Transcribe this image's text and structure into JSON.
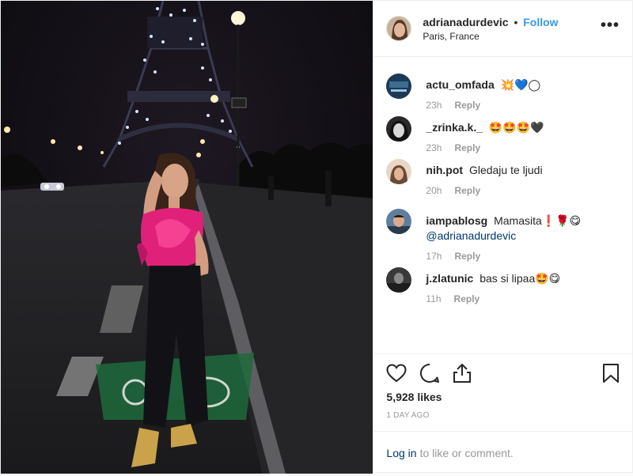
{
  "post": {
    "username": "adrianadurdevic",
    "separator": "•",
    "follow_label": "Follow",
    "location": "Paris, France",
    "more_label": "•••"
  },
  "comments": [
    {
      "user": "actu_omfada",
      "text": "💥💙◯",
      "time": "23h",
      "reply": "Reply"
    },
    {
      "user": "_zrinka.k._",
      "text": "🤩🤩🤩🖤",
      "time": "23h",
      "reply": "Reply"
    },
    {
      "user": "nih.pot",
      "text": "Gledaju te ljudi",
      "time": "20h",
      "reply": "Reply"
    },
    {
      "user": "iampablosg",
      "text": "Mamasita❗🌹😋",
      "mention": "@adrianadurdevic",
      "time": "17h",
      "reply": "Reply"
    },
    {
      "user": "j.zlatunic",
      "text": "bas si lipaa🤩😋",
      "time": "11h",
      "reply": "Reply"
    }
  ],
  "actions": {
    "icons": [
      "heart-icon",
      "comment-icon",
      "share-icon",
      "bookmark-icon"
    ],
    "likes": "5,928 likes",
    "date": "1 DAY AGO"
  },
  "login": {
    "link": "Log in",
    "text": "to like or comment."
  },
  "colors": {
    "link_blue": "#3897f0",
    "mention_blue": "#003569",
    "muted": "#999999",
    "border": "#efefef"
  }
}
